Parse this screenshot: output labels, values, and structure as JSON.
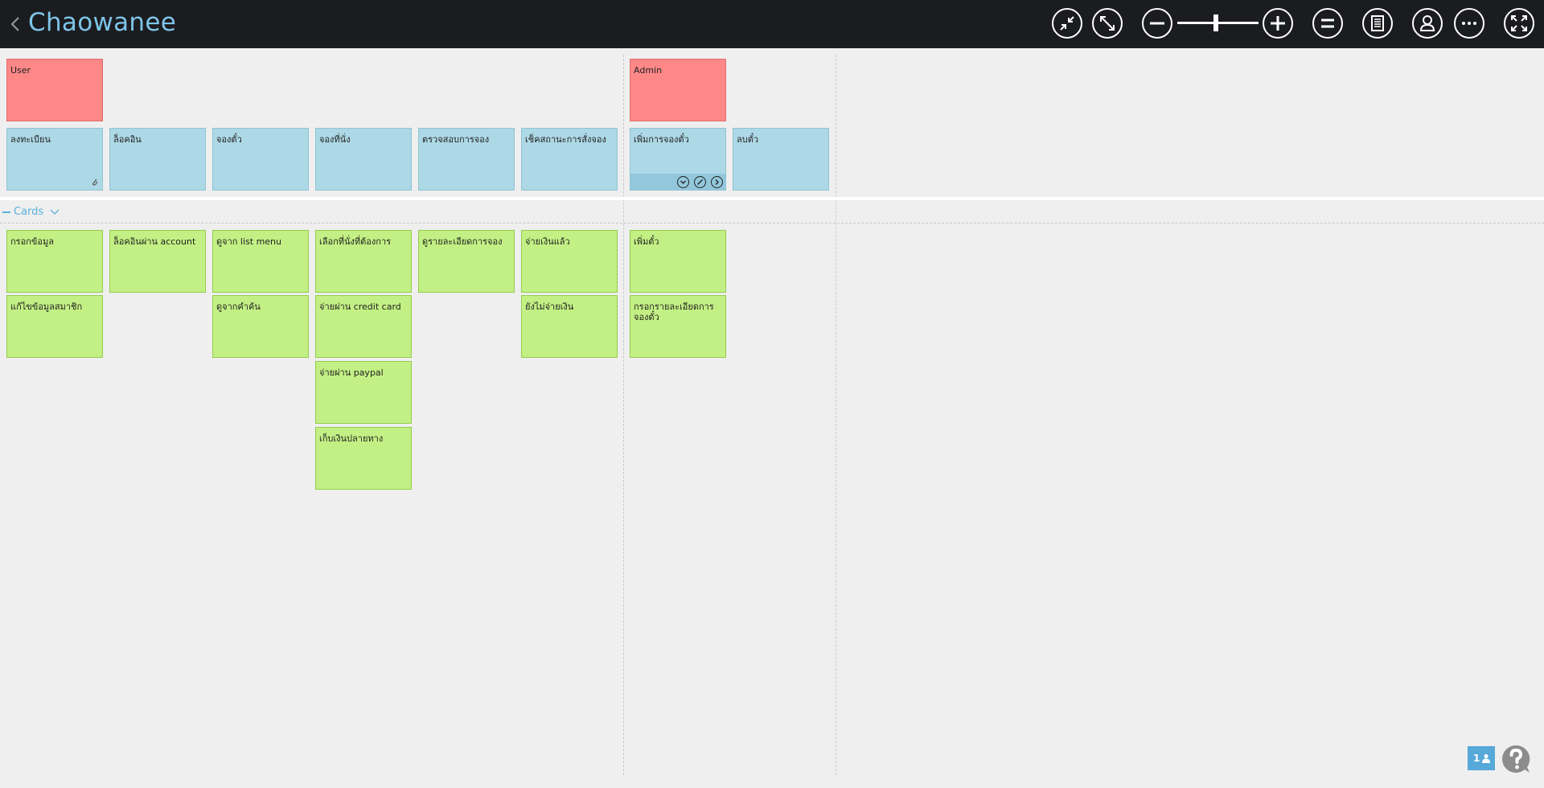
{
  "header": {
    "title": "Chaowanee",
    "icons": [
      "back-chevron-icon",
      "collapse-icon",
      "expand-icon",
      "zoom-out-icon",
      "zoom-in-icon",
      "equalize-icon",
      "list-icon",
      "user-icon",
      "more-icon",
      "fullscreen-icon"
    ],
    "zoom_level_fraction": 0.5
  },
  "colors": {
    "topbar": "#1b1c1f",
    "title": "#7ec4e8",
    "role_card": "#fe8888",
    "activity_card": "#add8e6",
    "story_card": "#c3f084",
    "accent": "#56a9d8"
  },
  "roles": {
    "user": "User",
    "admin": "Admin"
  },
  "activities": [
    "ลงทะเบียน",
    "ล็อคอิน",
    "จองตั๋ว",
    "จองที่นั่ง",
    "ตรวจสอบการจอง",
    "เช็คสถานะการสั่งจอง",
    "เพิ่มการจองตั๋ว",
    "ลบตั๋ว"
  ],
  "release": {
    "label": "Cards"
  },
  "stories": {
    "col1": [
      "กรอกข้อมูล",
      "แก้ไขข้อมูลสมาชิก"
    ],
    "col2": [
      "ล็อคอินผ่าน account"
    ],
    "col3": [
      "ดูจาก list menu",
      "ดูจากคำค้น"
    ],
    "col4": [
      "เลือกที่นั่งที่ต้องการ",
      "จ่ายผ่าน credit card",
      "จ่ายผ่าน paypal",
      "เก็บเงินปลายทาง"
    ],
    "col5": [
      "ดูรายละเอียดการจอง"
    ],
    "col6": [
      "จ่ายเงินแล้ว",
      "ยังไม่จ่ายเงิน"
    ],
    "col7": [
      "เพิ่มตั๋ว",
      "กรอกรายละเอียดการจองตั๋ว"
    ]
  },
  "footer": {
    "online_users": "1"
  }
}
